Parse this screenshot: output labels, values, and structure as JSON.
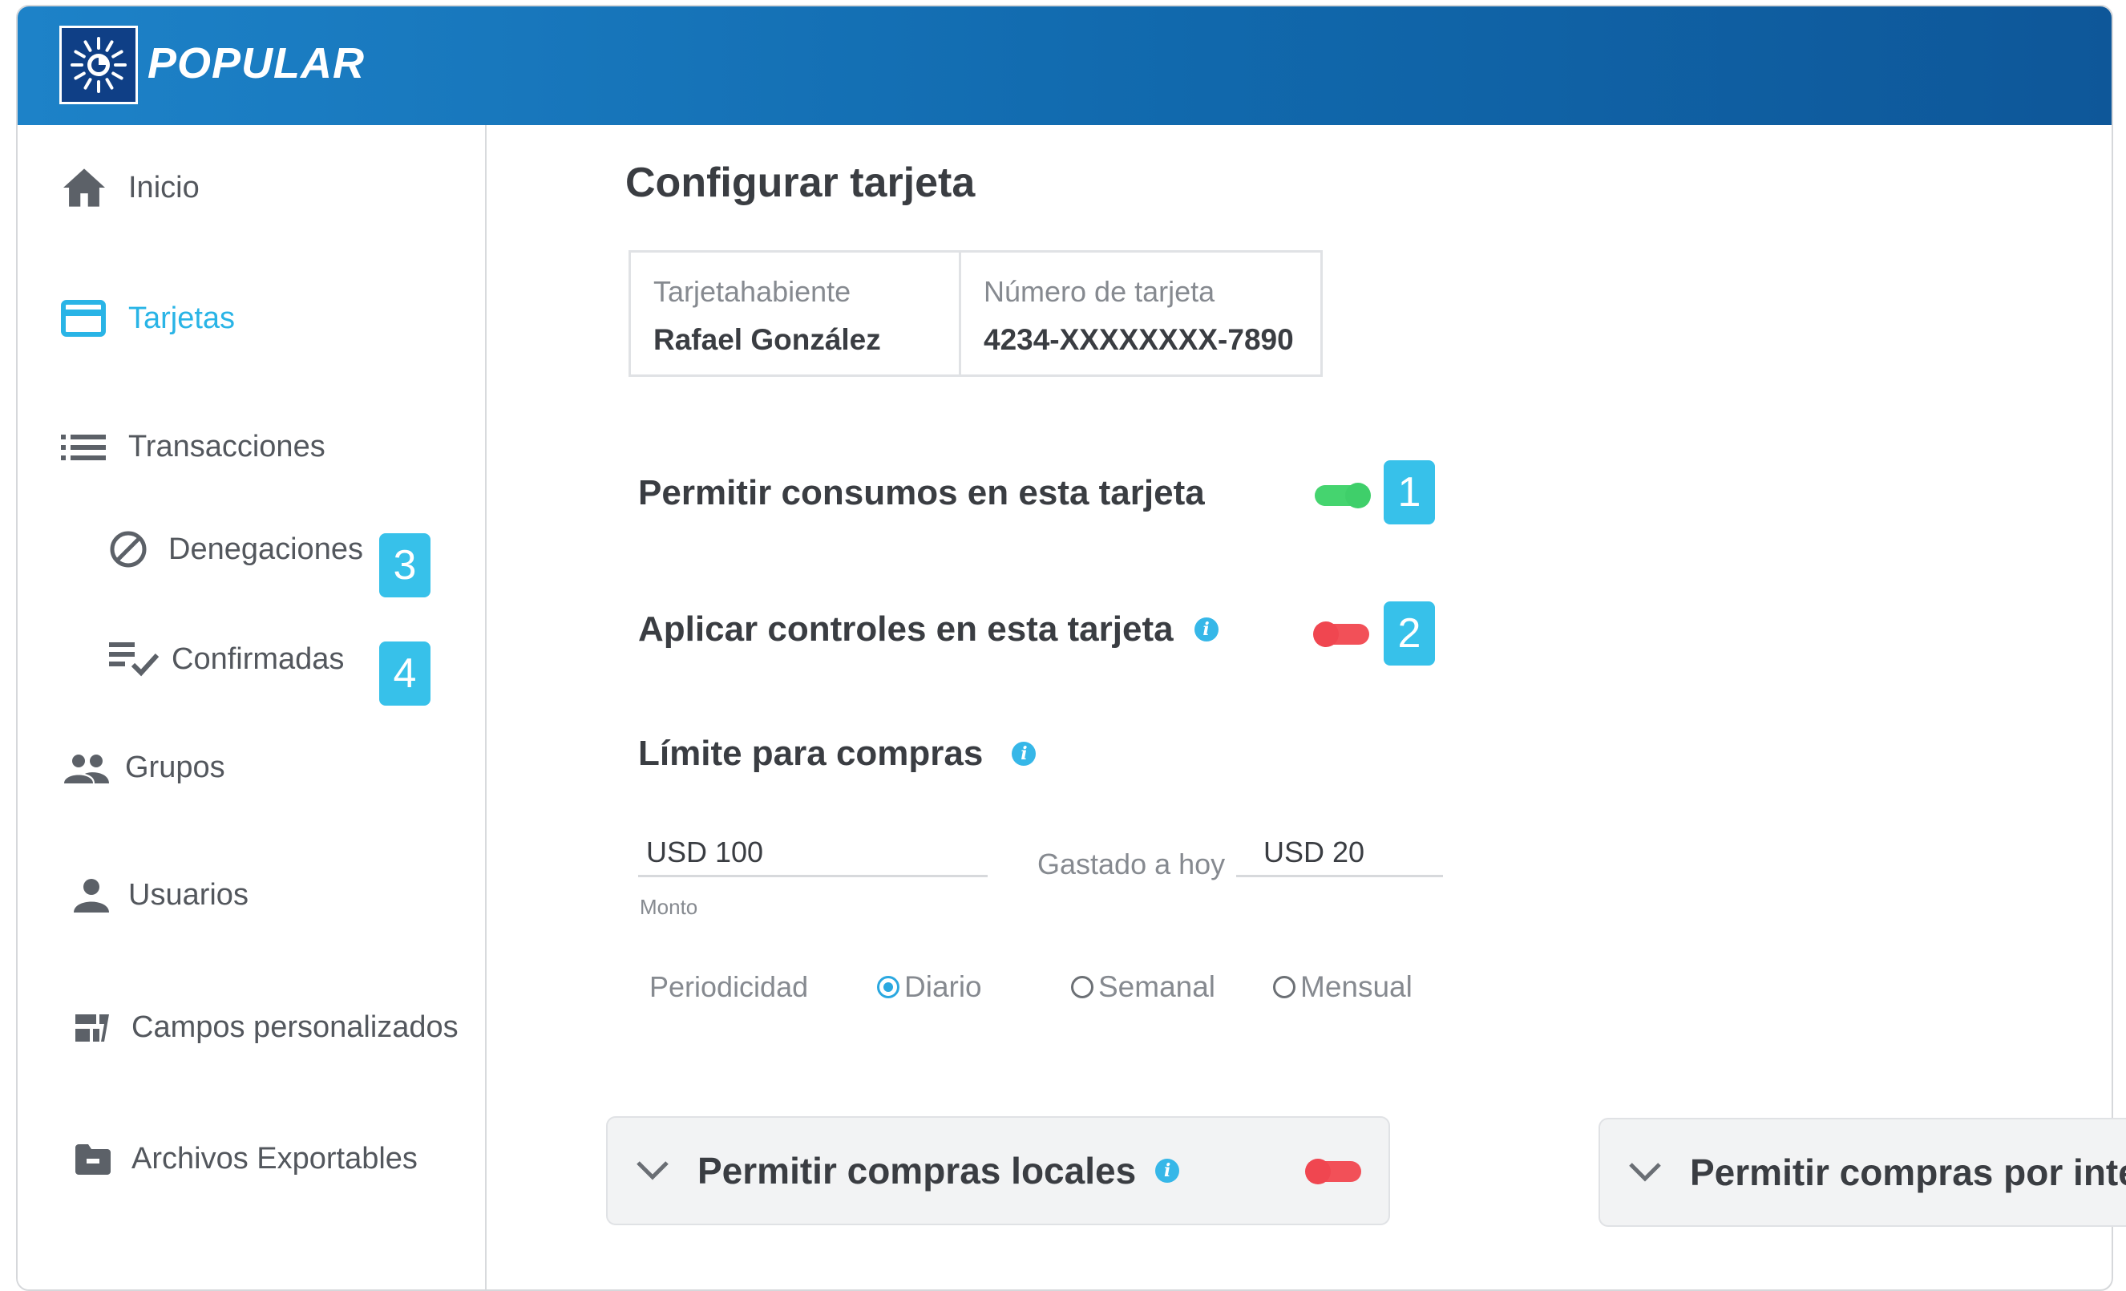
{
  "header": {
    "brand": "POPULAR"
  },
  "sidebar": {
    "items": [
      {
        "label": "Inicio",
        "icon": "home-icon"
      },
      {
        "label": "Tarjetas",
        "icon": "credit-card-icon",
        "active": true
      },
      {
        "label": "Transacciones",
        "icon": "list-icon"
      },
      {
        "label": "Denegaciones",
        "icon": "block-icon",
        "badge": "3"
      },
      {
        "label": "Confirmadas",
        "icon": "playlist-check-icon",
        "badge": "4"
      },
      {
        "label": "Grupos",
        "icon": "group-icon"
      },
      {
        "label": "Usuarios",
        "icon": "person-icon"
      },
      {
        "label": "Campos personalizados",
        "icon": "custom-fields-icon"
      },
      {
        "label": "Archivos Exportables",
        "icon": "folder-icon"
      }
    ]
  },
  "main": {
    "title": "Configurar tarjeta",
    "card": {
      "holder_label": "Tarjetahabiente",
      "holder_value": "Rafael González",
      "number_label": "Número de tarjeta",
      "number_value": "4234-XXXXXXXX-7890"
    },
    "settings": [
      {
        "label": "Permitir consumos en esta tarjeta",
        "enabled": true,
        "badge": "1"
      },
      {
        "label": "Aplicar controles en esta tarjeta",
        "enabled": false,
        "badge": "2"
      }
    ],
    "limit": {
      "title": "Límite para compras",
      "amount_value": "USD 100",
      "amount_caption": "Monto",
      "spent_label": "Gastado a hoy",
      "spent_value": "USD 20",
      "periodicity_label": "Periodicidad",
      "options": [
        "Diario",
        "Semanal",
        "Mensual"
      ],
      "selected": "Diario"
    },
    "panels": [
      {
        "label": "Permitir compras locales",
        "enabled": false
      },
      {
        "label": "Permitir compras por inte"
      }
    ]
  },
  "colors": {
    "header_start": "#1d82c8",
    "header_end": "#0e5799",
    "accent": "#29b4e6",
    "toggle_on": "#45d46f",
    "toggle_off": "#f25058",
    "badge": "#37c1ea"
  }
}
